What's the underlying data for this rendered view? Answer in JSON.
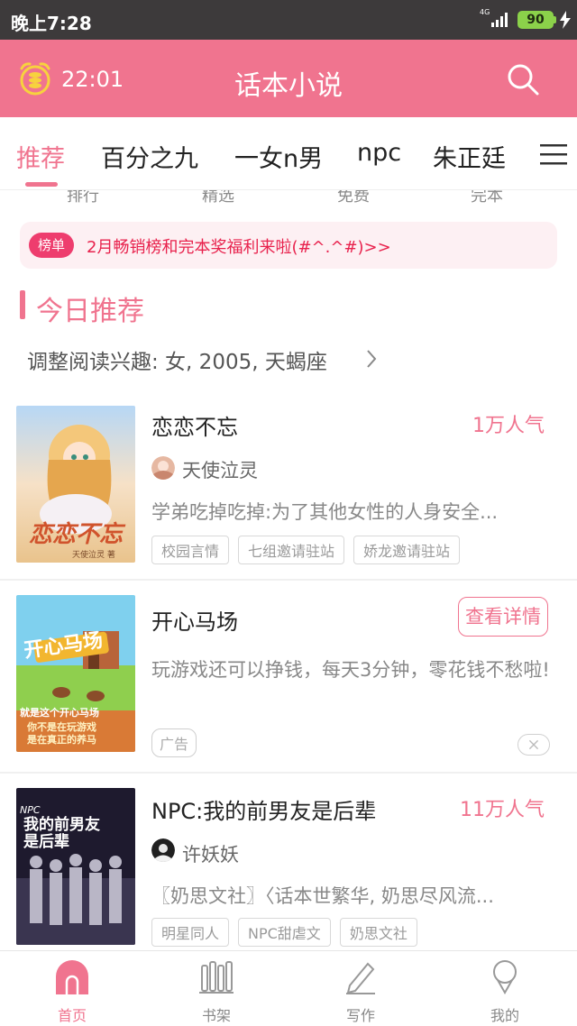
{
  "status_bar": {
    "time": "晚上7:28",
    "network": "4G",
    "battery": "90",
    "icons": [
      "signal-icon",
      "battery-icon",
      "charging-icon"
    ]
  },
  "header": {
    "clock_time": "22:01",
    "title": "话本小说",
    "icons": [
      "alarm-clock-icon",
      "search-icon"
    ]
  },
  "tabs": [
    {
      "label": "推荐",
      "active": true
    },
    {
      "label": "百分之九",
      "active": false
    },
    {
      "label": "一女n男",
      "active": false
    },
    {
      "label": "npc",
      "active": false
    },
    {
      "label": "朱正廷",
      "active": false
    }
  ],
  "categories": [
    "排行",
    "精选",
    "免费",
    "完本"
  ],
  "notice": {
    "badge": "榜单",
    "text": "2月畅销榜和完本奖福利来啦(#^.^#)>>"
  },
  "section": {
    "title": "今日推荐",
    "interest": "调整阅读兴趣: 女, 2005, 天蝎座"
  },
  "books": [
    {
      "title": "恋恋不忘",
      "popularity": "1万人气",
      "author": "天使泣灵",
      "description": "学弟吃掉吃掉:为了其他女性的人身安全...",
      "tags": [
        "校园言情",
        "七组邀请驻站",
        "娇龙邀请驻站"
      ],
      "cover_text": "恋恋不忘",
      "cover_sub": "天使泣灵 著"
    },
    {
      "title": "NPC:我的前男友是后辈",
      "popularity": "11万人气",
      "author": "许妖妖",
      "description": "〖奶思文社〗〈话本世繁华, 奶思尽风流...",
      "tags": [
        "明星同人",
        "NPC甜虐文",
        "奶思文社"
      ],
      "cover_text": "我的前男友是后辈",
      "cover_sub": "NPC"
    }
  ],
  "ad": {
    "title": "开心马场",
    "description": "玩游戏还可以挣钱，每天3分钟，零花钱不愁啦!",
    "button": "查看详情",
    "tag": "广告",
    "cover_text": "开心马场",
    "cover_line1": "就是这个开心马场",
    "cover_line2": "你不是在玩游戏",
    "cover_line3": "是在真正的养马"
  },
  "bottom_nav": [
    {
      "label": "首页",
      "icon": "home-icon",
      "active": true
    },
    {
      "label": "书架",
      "icon": "bookshelf-icon",
      "active": false
    },
    {
      "label": "写作",
      "icon": "pen-icon",
      "active": false
    },
    {
      "label": "我的",
      "icon": "profile-icon",
      "active": false
    }
  ],
  "colors": {
    "accent": "#f0748f",
    "status_bar": "#3d3a3b",
    "notice_text": "#e8224d"
  }
}
